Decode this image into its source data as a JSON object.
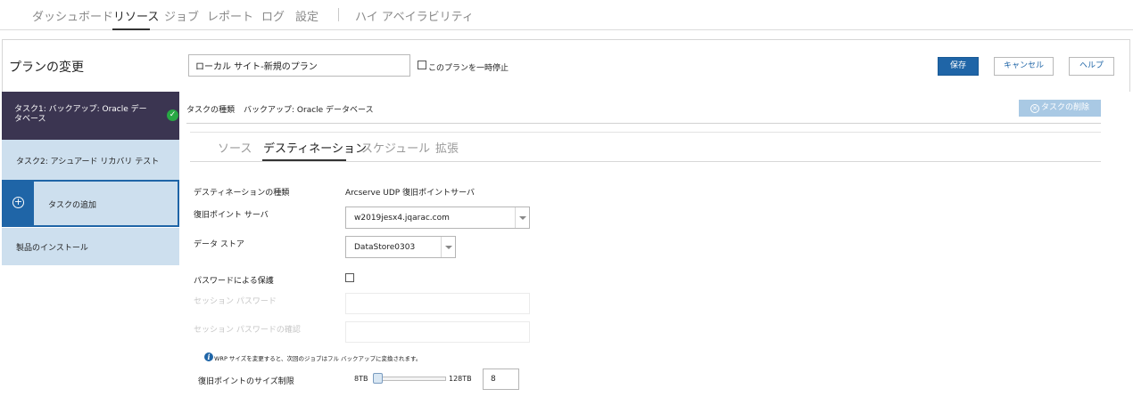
{
  "nav": {
    "items": [
      "ダッシュボード",
      "リソース",
      "ジョブ",
      "レポート",
      "ログ",
      "設定",
      "ハイ アベイラビリティ"
    ],
    "active": "リソース"
  },
  "plan": {
    "title": "プランの変更",
    "name_value": "ローカル サイト-新規のプラン",
    "pause_label": "このプランを一時停止",
    "pause_checked": false
  },
  "buttons": {
    "save": "保存",
    "cancel": "キャンセル",
    "help": "ヘルプ",
    "delete_task": "タスクの削除"
  },
  "sidebar": {
    "items": [
      {
        "label": "タスク1: バックアップ: Oracle データベース",
        "status": "complete"
      },
      {
        "label": "タスク2: アシュアード リカバリ テスト"
      },
      {
        "label": "タスクの追加"
      },
      {
        "label": "製品のインストール"
      }
    ]
  },
  "task": {
    "type_label": "タスクの種類",
    "type_value": "バックアップ: Oracle データベース"
  },
  "tabs": {
    "items": [
      "ソース",
      "デスティネーション",
      "スケジュール",
      "拡張"
    ],
    "active": "デスティネーション"
  },
  "form": {
    "dest_type_label": "デスティネーションの種類",
    "dest_type_value": "Arcserve UDP 復旧ポイントサーバ",
    "rps_label": "復旧ポイント サーバ",
    "rps_value": "w2019jesx4.jqarac.com",
    "datastore_label": "データ ストア",
    "datastore_value": "DataStore0303",
    "password_protect_label": "パスワードによる保護",
    "password_protect_checked": false,
    "session_password_label": "セッション パスワード",
    "session_password_confirm_label": "セッション パスワードの確認",
    "info_text": "WRP サイズを変更すると、次回のジョブはフル バックアップに変換されます。",
    "size_limit_label": "復旧ポイントのサイズ制限",
    "slider_min": "8TB",
    "slider_max": "128TB",
    "size_value": "8"
  },
  "colors": {
    "primary": "#1f65a7",
    "active_task_bg": "#3b3551",
    "sidebar_bg": "#cddfee",
    "success": "#27a844"
  }
}
